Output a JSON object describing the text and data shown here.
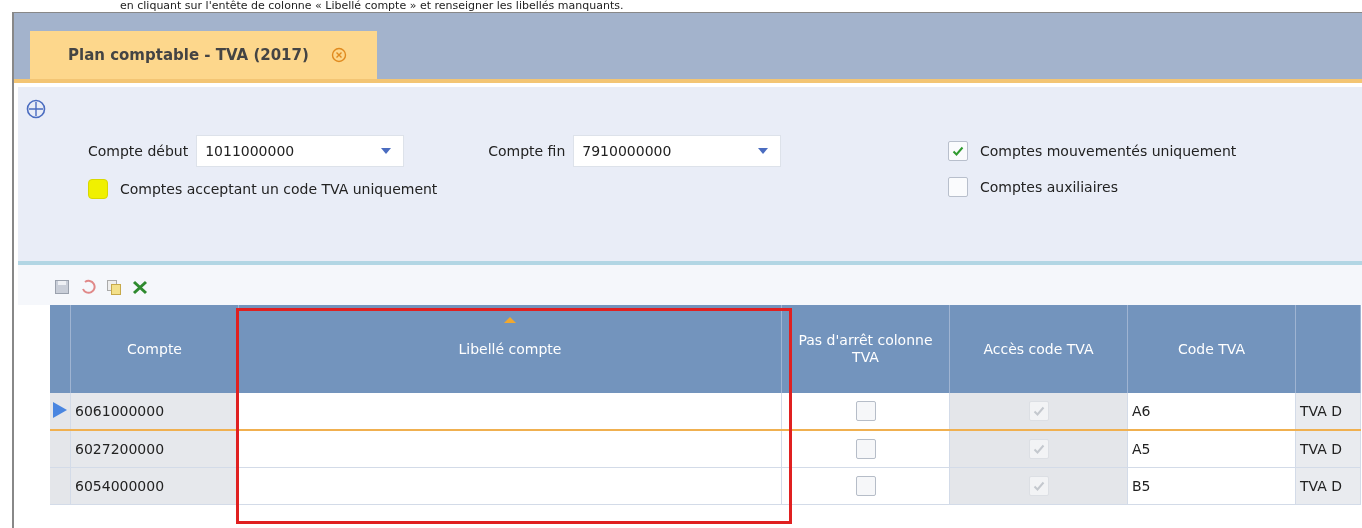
{
  "caption": "en cliquant sur l'entête de colonne « Libellé compte » et renseigner les libellés manquants.",
  "tab": {
    "title": "Plan comptable - TVA (2017)",
    "selected": true
  },
  "filters": {
    "fields": [
      {
        "label": "Compte début",
        "value": "1011000000"
      },
      {
        "label": "Compte fin",
        "value": "7910000000"
      }
    ],
    "options_main": [
      {
        "label": "Comptes acceptant un code TVA uniquement",
        "checked": false,
        "highlighted": true
      }
    ],
    "options_side": [
      {
        "label": "Comptes mouvementés uniquement",
        "checked": true
      },
      {
        "label": "Comptes auxiliaires",
        "checked": false
      }
    ]
  },
  "table": {
    "columns": [
      {
        "label": "Compte",
        "sorted": false
      },
      {
        "label": "Libellé compte",
        "sorted": true
      },
      {
        "label": "Pas d'arrêt colonne TVA",
        "sorted": false
      },
      {
        "label": "Accès code TVA",
        "sorted": false
      },
      {
        "label": "Code TVA",
        "sorted": false
      },
      {
        "sorted": false
      }
    ],
    "rows": [
      {
        "selected": true,
        "compte": "6061000000",
        "pas_arret": false,
        "acces": true,
        "code": "A6",
        "column_6": "TVA D"
      },
      {
        "selected": false,
        "compte": "6027200000",
        "pas_arret": false,
        "acces": true,
        "code": "A5",
        "column_6": "TVA D"
      },
      {
        "selected": false,
        "compte": "6054000000",
        "pas_arret": false,
        "acces": true,
        "code": "B5",
        "column_6": "TVA D"
      }
    ]
  }
}
